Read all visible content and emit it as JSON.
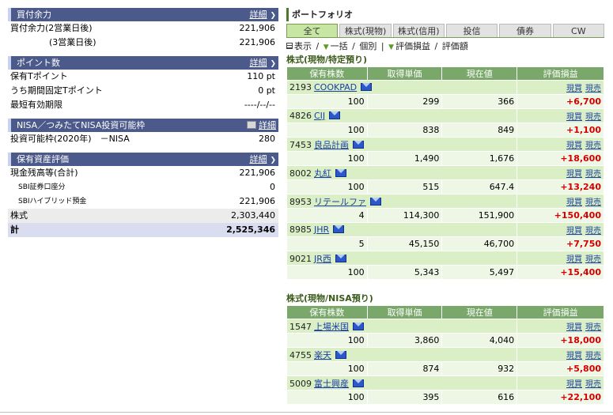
{
  "buying_power": {
    "title": "買付余力",
    "detail": "詳細",
    "rows": [
      {
        "label": "買付余力(2営業日後)",
        "value": "221,906"
      },
      {
        "label": "(3営業日後)",
        "value": "221,906"
      }
    ]
  },
  "points": {
    "title": "ポイント数",
    "detail": "詳細",
    "rows": [
      {
        "label": "保有Tポイント",
        "value": "110 pt"
      },
      {
        "label": "うち期間固定Tポイント",
        "value": "0 pt"
      },
      {
        "label": "最短有効期限",
        "value": "----/--/--"
      }
    ]
  },
  "nisa": {
    "title": "NISA／つみたてNISA投資可能枠",
    "detail": "詳細",
    "rows": [
      {
        "label": "投資可能枠(2020年)　－NISA",
        "value": "280"
      }
    ]
  },
  "assets": {
    "title": "保有資産評価",
    "detail": "詳細",
    "rows": [
      {
        "label": "現金残高等(合計)",
        "value": "221,906"
      },
      {
        "label": "SBI証券口座分",
        "value": "0"
      },
      {
        "label": "SBIハイブリッド預金",
        "value": "221,906"
      },
      {
        "label": "株式",
        "value": "2,303,440"
      },
      {
        "label": "計",
        "value": "2,525,346"
      }
    ]
  },
  "portfolio": {
    "title": "ポートフォリオ",
    "divider": "|",
    "tabs": [
      "全て",
      "株式(現物)",
      "株式(信用)",
      "投信",
      "債券",
      "CW"
    ],
    "controls": {
      "display": "表示",
      "sep": "/",
      "all": "一括",
      "individual": "個別",
      "eval_pl": "評価損益",
      "eval_amount": "評価額"
    },
    "columns": [
      "保有株数",
      "取得単価",
      "現在値",
      "評価損益"
    ],
    "actions": {
      "buy": "現買",
      "sell": "現売"
    },
    "groups": [
      {
        "title": "株式(現物/特定預り)",
        "rows": [
          {
            "code": "2193",
            "name": "COOKPAD",
            "qty": "100",
            "cost": "299",
            "price": "366",
            "pl": "+6,700"
          },
          {
            "code": "4826",
            "name": "CIJ",
            "qty": "100",
            "cost": "838",
            "price": "849",
            "pl": "+1,100"
          },
          {
            "code": "7453",
            "name": "良品計画",
            "qty": "100",
            "cost": "1,490",
            "price": "1,676",
            "pl": "+18,600"
          },
          {
            "code": "8002",
            "name": "丸紅",
            "qty": "100",
            "cost": "515",
            "price": "647.4",
            "pl": "+13,240"
          },
          {
            "code": "8953",
            "name": "リテールファ",
            "qty": "4",
            "cost": "114,300",
            "price": "151,900",
            "pl": "+150,400"
          },
          {
            "code": "8985",
            "name": "JHR",
            "qty": "5",
            "cost": "45,150",
            "price": "46,700",
            "pl": "+7,750"
          },
          {
            "code": "9021",
            "name": "JR西",
            "qty": "100",
            "cost": "5,343",
            "price": "5,497",
            "pl": "+15,400"
          }
        ]
      },
      {
        "title": "株式(現物/NISA預り)",
        "rows": [
          {
            "code": "1547",
            "name": "上場米国",
            "qty": "100",
            "cost": "3,860",
            "price": "4,040",
            "pl": "+18,000"
          },
          {
            "code": "4755",
            "name": "楽天",
            "qty": "100",
            "cost": "874",
            "price": "932",
            "pl": "+5,800"
          },
          {
            "code": "5009",
            "name": "富士興産",
            "qty": "100",
            "cost": "395",
            "price": "616",
            "pl": "+22,100"
          }
        ]
      }
    ]
  },
  "colors": {
    "header_bg": "#4b5a8a",
    "table_header": "#7aa86a",
    "profit": "#d40000",
    "link": "#1a3fa3"
  }
}
